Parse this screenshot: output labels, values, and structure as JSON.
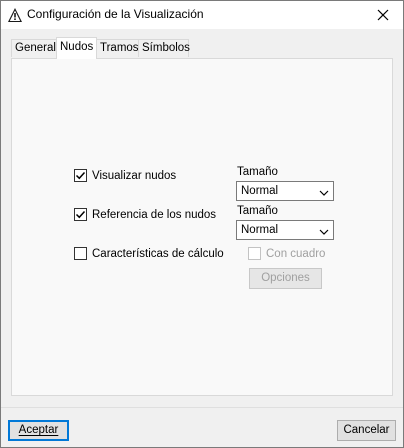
{
  "window": {
    "title": "Configuración de la Visualización",
    "icon": "warning-triangle-icon"
  },
  "tabs": [
    {
      "label": "General",
      "active": false
    },
    {
      "label": "Nudos",
      "active": true
    },
    {
      "label": "Tramos",
      "active": false
    },
    {
      "label": "Símbolos",
      "active": false
    }
  ],
  "panel": {
    "visualizar_nudos": {
      "label": "Visualizar nudos",
      "checked": true
    },
    "referencia_nudos": {
      "label": "Referencia de los nudos",
      "checked": true
    },
    "caracteristicas": {
      "label": "Características de cálculo",
      "checked": false
    },
    "size1": {
      "label": "Tamaño",
      "value": "Normal"
    },
    "size2": {
      "label": "Tamaño",
      "value": "Normal"
    },
    "con_cuadro": {
      "label": "Con cuadro",
      "checked": false,
      "disabled": true
    },
    "opciones": {
      "label": "Opciones",
      "disabled": true
    }
  },
  "footer": {
    "accept_label": "Aceptar",
    "cancel_label": "Cancelar"
  }
}
